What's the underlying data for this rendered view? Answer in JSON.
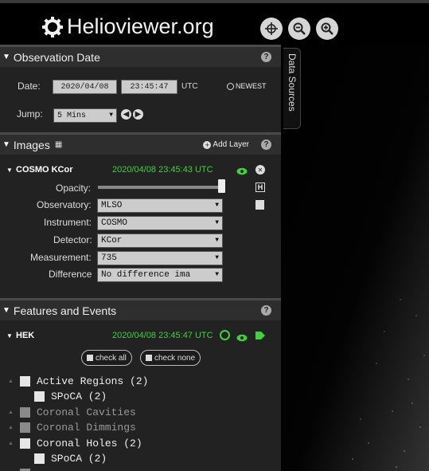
{
  "header": {
    "brand": "Helioviewer.org",
    "buttons": [
      "center-viewport-icon",
      "zoom-out-icon",
      "zoom-in-icon"
    ]
  },
  "observation": {
    "title": "Observation Date",
    "date_label": "Date:",
    "date": "2020/04/08",
    "time": "23:45:47",
    "tz": "UTC",
    "newest": "NEWEST",
    "jump_label": "Jump:",
    "jump_value": "5 Mins"
  },
  "images": {
    "title": "Images",
    "add_layer": "Add Layer",
    "layer": {
      "name": "COSMO KCor",
      "timestamp": "2020/04/08 23:45:43 UTC",
      "opacity_label": "Opacity:",
      "opacity": 1.0,
      "observatory_label": "Observatory:",
      "observatory": "MLSO",
      "instrument_label": "Instrument:",
      "instrument": "COSMO",
      "detector_label": "Detector:",
      "detector": "KCor",
      "measurement_label": "Measurement:",
      "measurement": "735",
      "difference_label": "Difference",
      "difference": "No difference ima"
    }
  },
  "features": {
    "title": "Features and Events",
    "source": "HEK",
    "timestamp": "2020/04/08 23:45:47 UTC",
    "check_all": "check all",
    "check_none": "check none",
    "tree": [
      {
        "label": "Active Regions (2)",
        "dim": false
      },
      {
        "label": "SPoCA (2)",
        "dim": false,
        "child": true
      },
      {
        "label": "Coronal Cavities",
        "dim": true
      },
      {
        "label": "Coronal Dimmings",
        "dim": true
      },
      {
        "label": "Coronal Holes (2)",
        "dim": false
      },
      {
        "label": "SPoCA (2)",
        "dim": false,
        "child": true
      }
    ]
  },
  "data_sources_tab": "Data Sources",
  "colors": {
    "accent_green": "#3fd23f",
    "panel": "#222222",
    "header_bar": "#2e2e2e"
  }
}
